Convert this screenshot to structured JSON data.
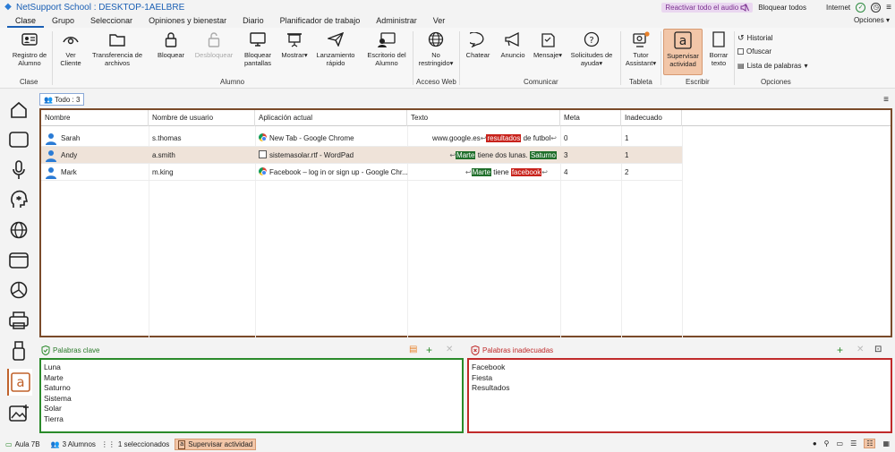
{
  "window": {
    "title": "NetSupport School : DESKTOP-1AELBRE",
    "reactivate_audio": "Reactivar todo el audio",
    "lock_all": "Bloquear todos",
    "internet": "Internet"
  },
  "menu": {
    "items": [
      "Clase",
      "Grupo",
      "Seleccionar",
      "Opiniones y bienestar",
      "Diario",
      "Planificador de trabajo",
      "Administrar",
      "Ver"
    ],
    "options": "Opciones"
  },
  "ribbon": {
    "buttons": {
      "registro": "Registro de Alumno",
      "ver_cliente": "Ver Cliente",
      "transferencia": "Transferencia de archivos",
      "bloquear": "Bloquear",
      "desbloquear": "Desbloquear",
      "bloquear_pantallas": "Bloquear pantallas",
      "mostrar": "Mostrar",
      "lanzamiento": "Lanzamiento rápido",
      "escritorio": "Escritorio del Alumno",
      "no_restringido": "No restringido",
      "chatear": "Chatear",
      "anuncio": "Anuncio",
      "mensaje": "Mensaje",
      "solicitudes": "Solicitudes de ayuda",
      "tutor": "Tutor Assistant",
      "supervisar": "Supervisar actividad",
      "borrar": "Borrar texto"
    },
    "groups": {
      "clase": "Clase",
      "alumno": "Alumno",
      "acceso_web": "Acceso Web",
      "comunicar": "Comunicar",
      "tableta": "Tableta",
      "escribir": "Escribir",
      "opciones": "Opciones"
    },
    "options": {
      "historial": "Historial",
      "ofuscar": "Ofuscar",
      "lista": "Lista de palabras"
    }
  },
  "filter": {
    "label": "Todo : 3"
  },
  "table": {
    "headers": [
      "Nombre",
      "Nombre de usuario",
      "Aplicación actual",
      "Texto",
      "Meta",
      "Inadecuado"
    ],
    "rows": [
      {
        "name": "Sarah",
        "user": "s.thomas",
        "app": "New Tab - Google Chrome",
        "app_icon": "chrome-icon",
        "text": {
          "pre": "www.google.es",
          "t1": "resultados",
          "mid": " de futbol",
          "t2": ""
        },
        "meta": "0",
        "inad": "1"
      },
      {
        "name": "Andy",
        "user": "a.smith",
        "app": "sistemasolar.rtf - WordPad",
        "app_icon": "wordpad-icon",
        "text": {
          "pre": "",
          "t1": "Marte",
          "mid": " tiene dos lunas. ",
          "t2": "Saturno"
        },
        "meta": "3",
        "inad": "1"
      },
      {
        "name": "Mark",
        "user": "m.king",
        "app": "Facebook – log in or sign up - Google Chr...",
        "app_icon": "chrome-icon",
        "text": {
          "pre": "",
          "t1": "Marte",
          "mid": " tiene ",
          "t2": "facebook"
        },
        "meta": "4",
        "inad": "2"
      }
    ]
  },
  "keywords": {
    "title": "Palabras clave",
    "items": [
      "Luna",
      "Marte",
      "Saturno",
      "Sistema",
      "Solar",
      "Tierra"
    ]
  },
  "inappropriate": {
    "title": "Palabras inadecuadas",
    "items": [
      "Facebook",
      "Fiesta",
      "Resultados"
    ]
  },
  "status": {
    "room": "Aula 7B",
    "students": "3 Alumnos",
    "selected": "1 seleccionados",
    "mode": "Supervisar actividad"
  },
  "colors": {
    "accent": "#1a5fb4",
    "selected": "#f2c6a8",
    "keyword": "#1f6e2a",
    "inappropriate": "#c8221b"
  }
}
